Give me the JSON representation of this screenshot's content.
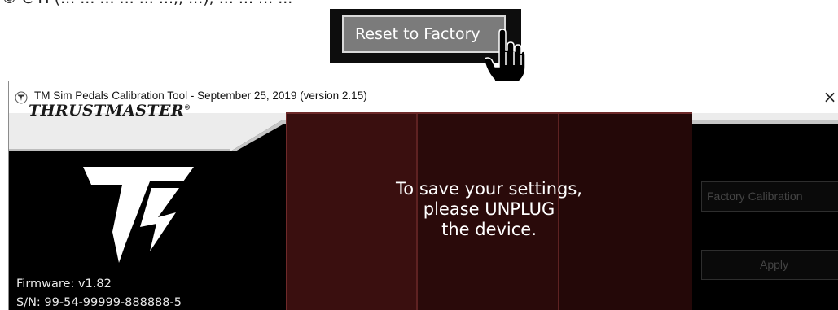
{
  "callout": {
    "reset_button_label": "Reset to Factory",
    "top_caption_fragment": "© C H (... ... ... ... ... ...,, ...), ... ... ...   ..."
  },
  "window": {
    "title": "TM Sim Pedals Calibration Tool - September 25, 2019 (version 2.15)",
    "close_symbol": "×",
    "brand": "THRUSTMASTER",
    "brand_mark": "®"
  },
  "left_panel": {
    "firmware": "Firmware: v1.82",
    "serial": "S/N: 99-54-99999-888888-5"
  },
  "center_panel": {
    "message_lines": [
      "To save your settings,",
      "please UNPLUG",
      "the device."
    ]
  },
  "right_panel": {
    "factory_button": "Factory Calibration",
    "apply_button": "Apply"
  },
  "colors": {
    "panel_red": "#3a0f0f",
    "panel_border": "#6e2a2a",
    "button_gray": "#7b7b7b",
    "background": "#000000"
  }
}
